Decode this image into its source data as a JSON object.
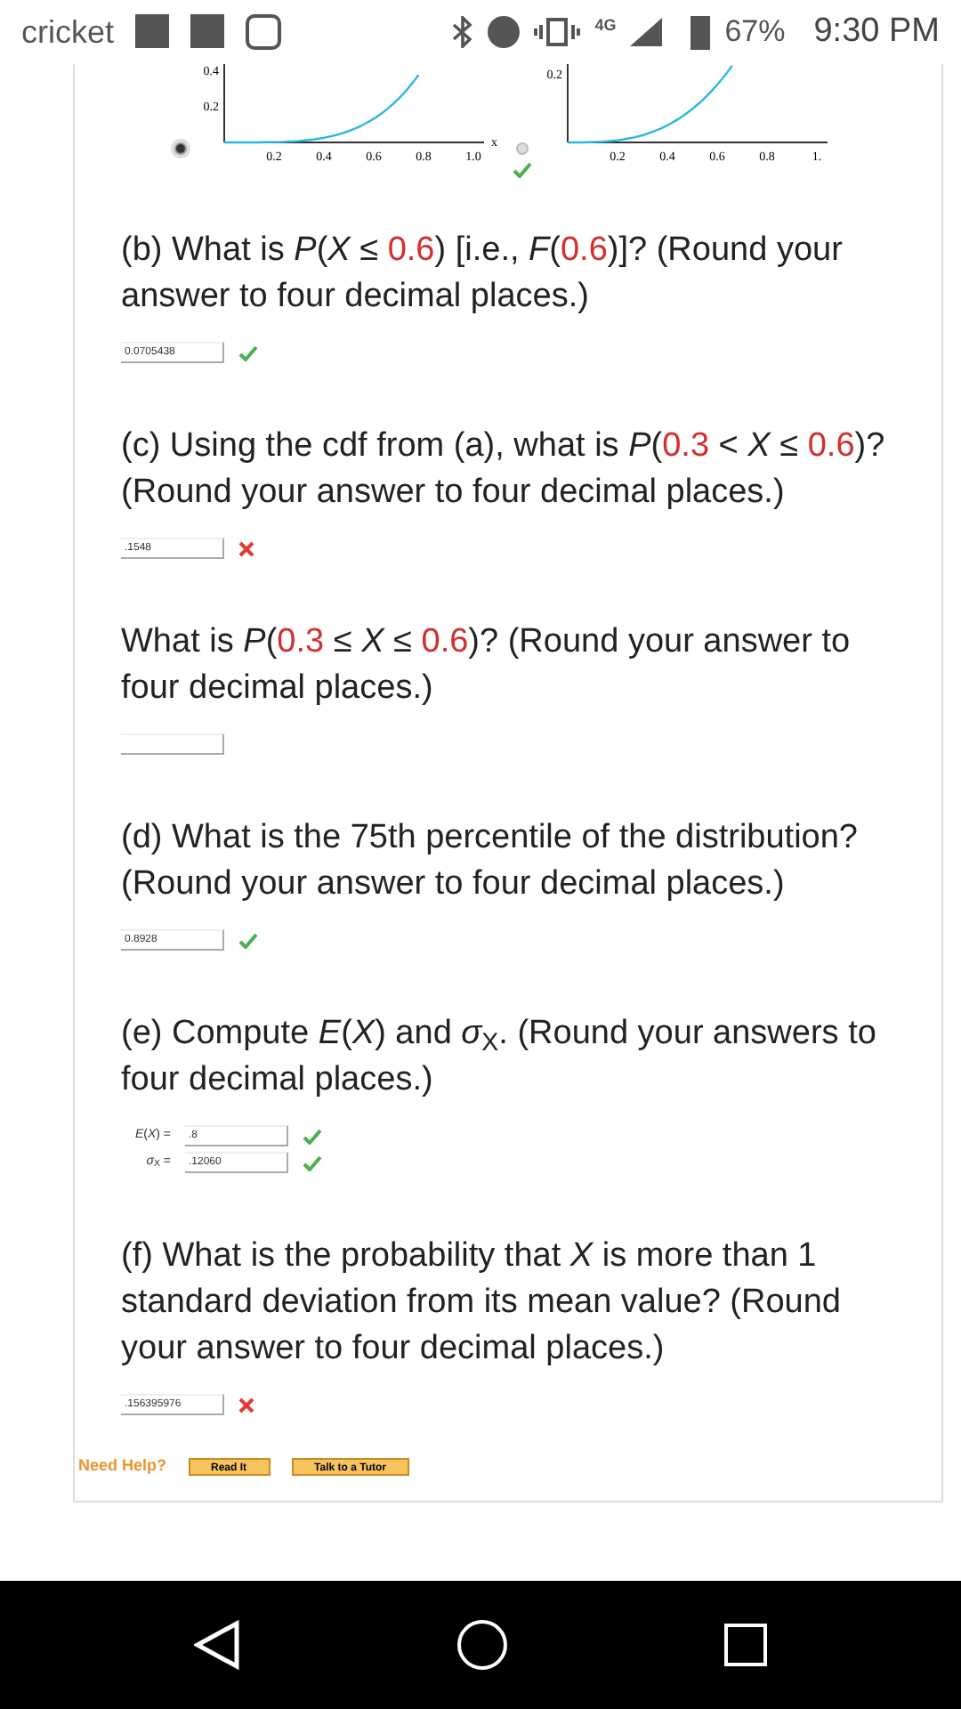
{
  "status_bar": {
    "carrier": "cricket",
    "network": "4G",
    "battery": "67%",
    "time": "9:30 PM"
  },
  "graphs": [
    {
      "selected": true,
      "y_ticks": [
        "0.4",
        "0.2"
      ],
      "x_ticks": [
        "0.2",
        "0.4",
        "0.6",
        "0.8",
        "1.0"
      ],
      "axis_label": "x"
    },
    {
      "selected": false,
      "correct": true,
      "y_ticks": [
        "0.2"
      ],
      "x_ticks": [
        "0.2",
        "0.4",
        "0.6",
        "0.8",
        "1."
      ]
    }
  ],
  "questions": [
    {
      "segments": [
        {
          "kind": "text",
          "text": "(b) What is *P*(*X* ≤ "
        },
        {
          "kind": "value",
          "text": "0.6"
        },
        {
          "kind": "text",
          "text": ") [i.e., *F*("
        },
        {
          "kind": "value",
          "text": "0.6"
        },
        {
          "kind": "text",
          "text": ")]? (Round your answer to four decimal places.)"
        }
      ],
      "answers": [
        {
          "value": "0.0705438",
          "correct": true
        }
      ]
    },
    {
      "segments": [
        {
          "kind": "text",
          "text": "(c) Using the cdf from (a), what is *P*("
        },
        {
          "kind": "value",
          "text": "0.3"
        },
        {
          "kind": "text",
          "text": " < *X* ≤ "
        },
        {
          "kind": "value",
          "text": "0.6"
        },
        {
          "kind": "text",
          "text": ")? (Round your answer to four decimal places.)"
        }
      ],
      "answers": [
        {
          "value": ".1548",
          "correct": false
        }
      ]
    },
    {
      "segments": [
        {
          "kind": "text",
          "text": "What is *P*("
        },
        {
          "kind": "value",
          "text": "0.3"
        },
        {
          "kind": "text",
          "text": " ≤ *X* ≤ "
        },
        {
          "kind": "value",
          "text": "0.6"
        },
        {
          "kind": "text",
          "text": ")? (Round your answer to four decimal places.)"
        }
      ],
      "answers": [
        {
          "kind": "field"
        }
      ]
    },
    {
      "segments": [
        {
          "kind": "text",
          "text": "(d) What is the 75th percentile of the distribution? (Round your answer to four decimal places.)"
        }
      ],
      "answers": [
        {
          "value": "0.8928",
          "correct": true
        }
      ]
    },
    {
      "segments": [
        {
          "kind": "text",
          "text": "(e) Compute *E*(*X*) and *σ*$_{X}$. (Round your answers to four decimal places.)"
        }
      ],
      "answers": [
        {
          "label": "*E*(*X*) =",
          "value": ".8",
          "correct": true
        },
        {
          "label": "*σ*$_{X}$ =",
          "value": ".12060",
          "correct": true
        }
      ]
    },
    {
      "segments": [
        {
          "kind": "text",
          "text": "(f) What is the probability that *X* is more than 1 standard deviation from its mean value? (Round your answer to four decimal places.)"
        }
      ],
      "answers": [
        {
          "value": ".156395976",
          "correct": false
        }
      ]
    }
  ],
  "help": {
    "label": "Need Help?",
    "buttons": [
      "Read It",
      "Talk to a Tutor"
    ]
  }
}
